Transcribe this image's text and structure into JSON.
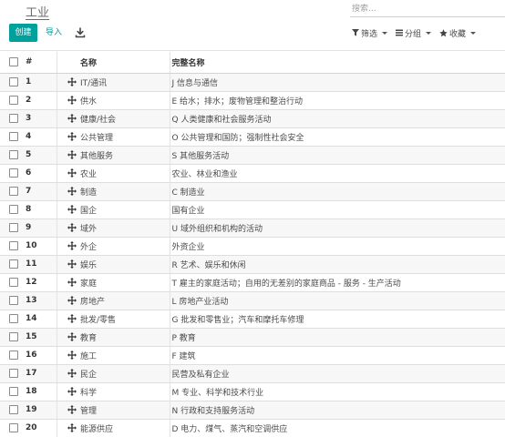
{
  "breadcrumb": "工业",
  "search": {
    "placeholder": "搜索..."
  },
  "toolbar": {
    "create_label": "创建",
    "import_label": "导入",
    "download_icon": "download-icon"
  },
  "filters": [
    {
      "label": "筛选",
      "icon": "filter-icon"
    },
    {
      "label": "分组",
      "icon": "group-icon"
    },
    {
      "label": "收藏",
      "icon": "star-icon"
    }
  ],
  "table": {
    "headers": {
      "num": "#",
      "name": "名称",
      "full_name": "完整名称"
    },
    "rows": [
      {
        "num": "1",
        "name": "IT/通讯",
        "full_name": "J 信息与通信"
      },
      {
        "num": "2",
        "name": "供水",
        "full_name": "E 给水；排水；废物管理和整治行动"
      },
      {
        "num": "3",
        "name": "健康/社会",
        "full_name": "Q 人类健康和社会服务活动"
      },
      {
        "num": "4",
        "name": "公共管理",
        "full_name": "O 公共管理和国防；强制性社会安全"
      },
      {
        "num": "5",
        "name": "其他服务",
        "full_name": "S 其他服务活动"
      },
      {
        "num": "6",
        "name": "农业",
        "full_name": "农业、林业和渔业"
      },
      {
        "num": "7",
        "name": "制造",
        "full_name": "C 制造业"
      },
      {
        "num": "8",
        "name": "国企",
        "full_name": "国有企业"
      },
      {
        "num": "9",
        "name": "域外",
        "full_name": "U 域外组织和机构的活动"
      },
      {
        "num": "10",
        "name": "外企",
        "full_name": "外资企业"
      },
      {
        "num": "11",
        "name": "娱乐",
        "full_name": "R 艺术、娱乐和休闲"
      },
      {
        "num": "12",
        "name": "家庭",
        "full_name": "T 雇主的家庭活动；自用的无差别的家庭商品 - 服务 - 生产活动"
      },
      {
        "num": "13",
        "name": "房地产",
        "full_name": "L 房地产业活动"
      },
      {
        "num": "14",
        "name": "批发/零售",
        "full_name": "G 批发和零售业；汽车和摩托车修理"
      },
      {
        "num": "15",
        "name": "教育",
        "full_name": "P 教育"
      },
      {
        "num": "16",
        "name": "施工",
        "full_name": "F 建筑"
      },
      {
        "num": "17",
        "name": "民企",
        "full_name": "民营及私有企业"
      },
      {
        "num": "18",
        "name": "科学",
        "full_name": "M 专业、科学和技术行业"
      },
      {
        "num": "19",
        "name": "管理",
        "full_name": "N 行政和支持服务活动"
      },
      {
        "num": "20",
        "name": "能源供应",
        "full_name": "D 电力、煤气、蒸汽和空调供应"
      }
    ]
  },
  "colors": {
    "accent": "#00a09d",
    "stripe": "#f7f7f7"
  }
}
